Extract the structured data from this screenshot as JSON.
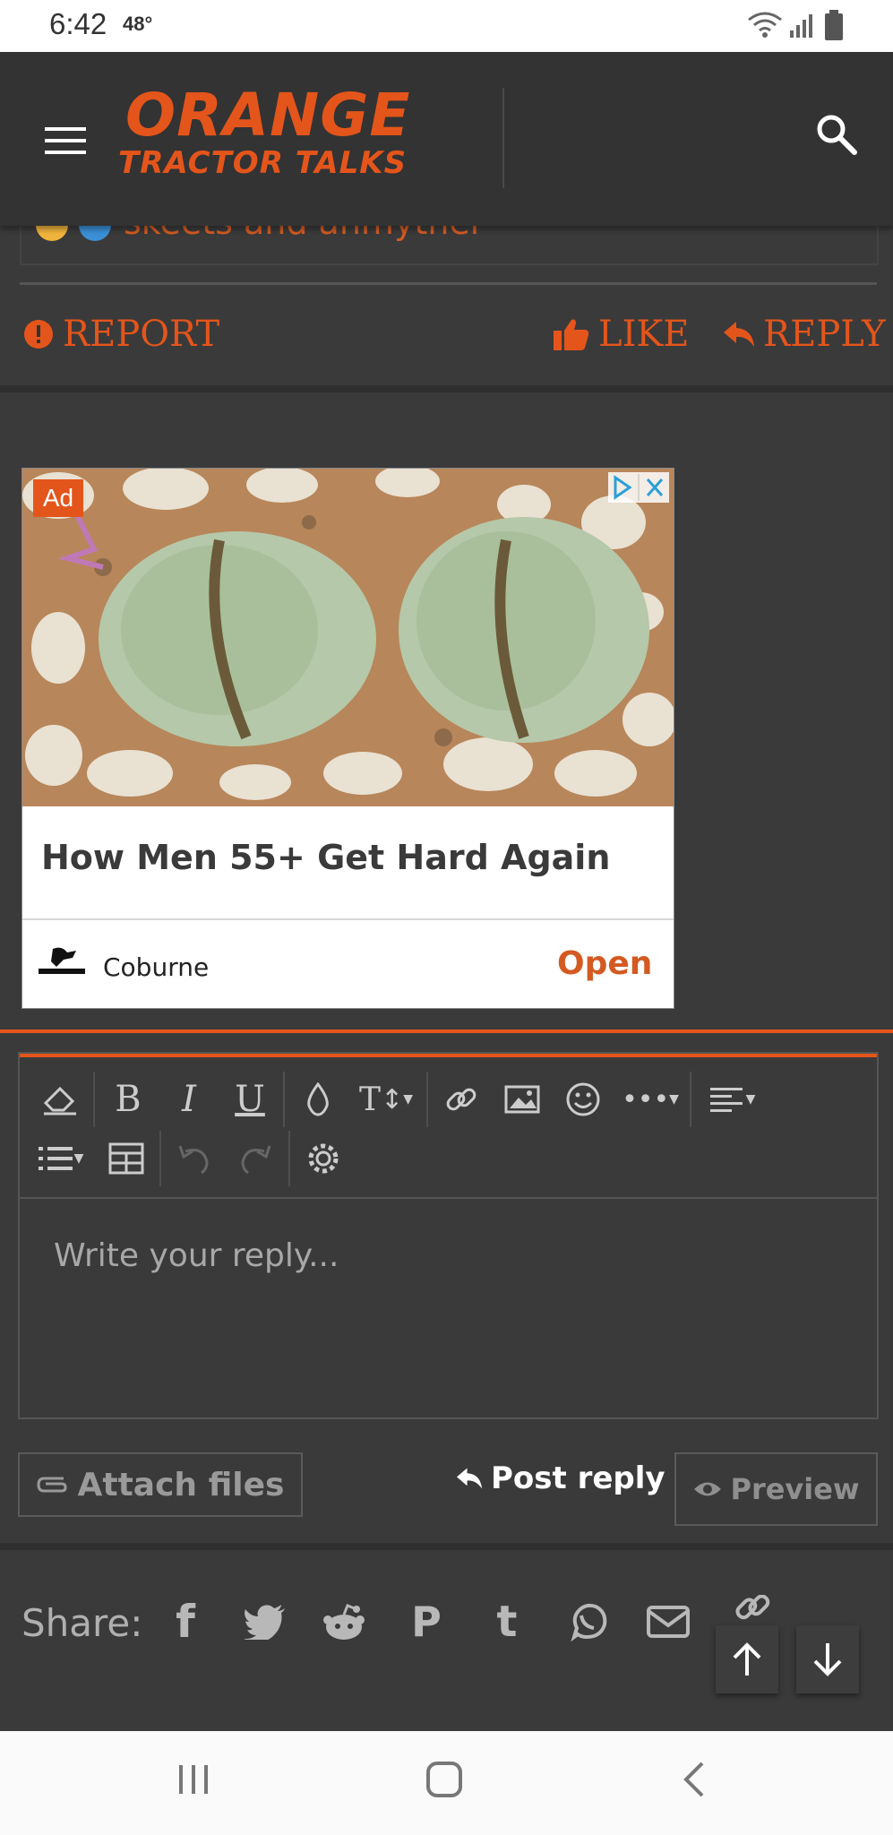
{
  "status_bar": {
    "time": "6:42",
    "temp": "48°"
  },
  "header": {
    "logo_line1": "ORANGE",
    "logo_line2": "TRACTOR TALKS"
  },
  "post": {
    "text_fragment": "skeets and anmyther",
    "report_label": "REPORT",
    "like_label": "LIKE",
    "reply_label": "REPLY"
  },
  "ad": {
    "badge": "Ad",
    "title": "How Men 55+ Get Hard Again",
    "brand": "Coburne",
    "open_label": "Open"
  },
  "editor": {
    "placeholder": "Write your reply...",
    "toolbar": [
      "eraser-icon",
      "bold-icon",
      "italic-icon",
      "underline-icon",
      "text-color-icon",
      "font-size-icon",
      "link-icon",
      "image-icon",
      "smiley-icon",
      "more-icon",
      "align-icon",
      "list-icon",
      "table-icon",
      "undo-icon",
      "redo-icon",
      "settings-icon"
    ]
  },
  "buttons": {
    "attach": "Attach files",
    "post_reply": "Post reply",
    "preview": "Preview"
  },
  "share": {
    "label": "Share:",
    "icons": [
      "facebook-icon",
      "twitter-icon",
      "reddit-icon",
      "pinterest-icon",
      "tumblr-icon",
      "whatsapp-icon",
      "email-icon",
      "link-icon"
    ]
  },
  "colors": {
    "accent": "#e4551b",
    "background": "#3a3a3a",
    "header": "#333333"
  }
}
